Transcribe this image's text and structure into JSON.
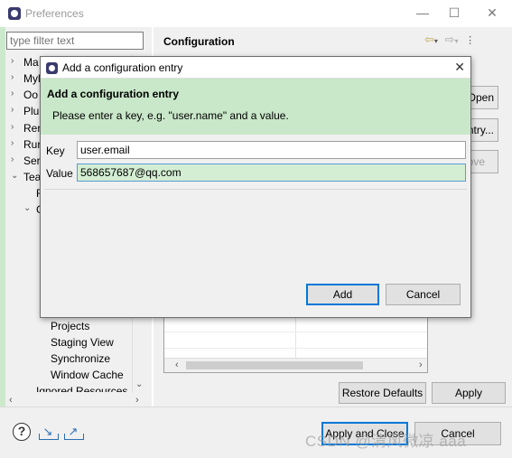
{
  "window": {
    "title": "Preferences",
    "minimize": "—",
    "maximize": "☐",
    "close": "✕"
  },
  "filter": {
    "placeholder": "type filter text"
  },
  "tree": {
    "items": [
      {
        "label": "Ma",
        "arrow": "›"
      },
      {
        "label": "Myl",
        "arrow": "›"
      },
      {
        "label": "Oo",
        "arrow": "›"
      },
      {
        "label": "Plu",
        "arrow": "›"
      },
      {
        "label": "Rer",
        "arrow": "›"
      },
      {
        "label": "Rur",
        "arrow": "›"
      },
      {
        "label": "Ser",
        "arrow": "›"
      },
      {
        "label": "Tea",
        "arrow": "⌄"
      },
      {
        "label": "F",
        "arrow": ""
      },
      {
        "label": "G",
        "arrow": "⌄"
      }
    ],
    "lower_items": [
      "Projects",
      "Staging View",
      "Synchronize",
      "Window Cache",
      "Ignored Resources"
    ]
  },
  "page": {
    "title": "Configuration",
    "open_button": "Open",
    "entry_button": "ntry...",
    "remove_button": "ove",
    "restore_defaults": "Restore Defaults",
    "apply": "Apply"
  },
  "footer": {
    "apply_and_close": "Apply and Close",
    "cancel": "Cancel"
  },
  "watermark": "CSDN @清风微凉 aaa",
  "dialog": {
    "window_title": "Add a configuration entry",
    "heading": "Add a configuration entry",
    "description": "Please enter a key, e.g. \"user.name\" and a value.",
    "key_label": "Key",
    "key_value": "user.email",
    "value_label": "Value",
    "value_value": "568657687@qq.com",
    "add_button": "Add",
    "cancel_button": "Cancel",
    "close": "✕"
  },
  "colors": {
    "banner": "#c9e7c9",
    "accent": "#0078d7"
  }
}
